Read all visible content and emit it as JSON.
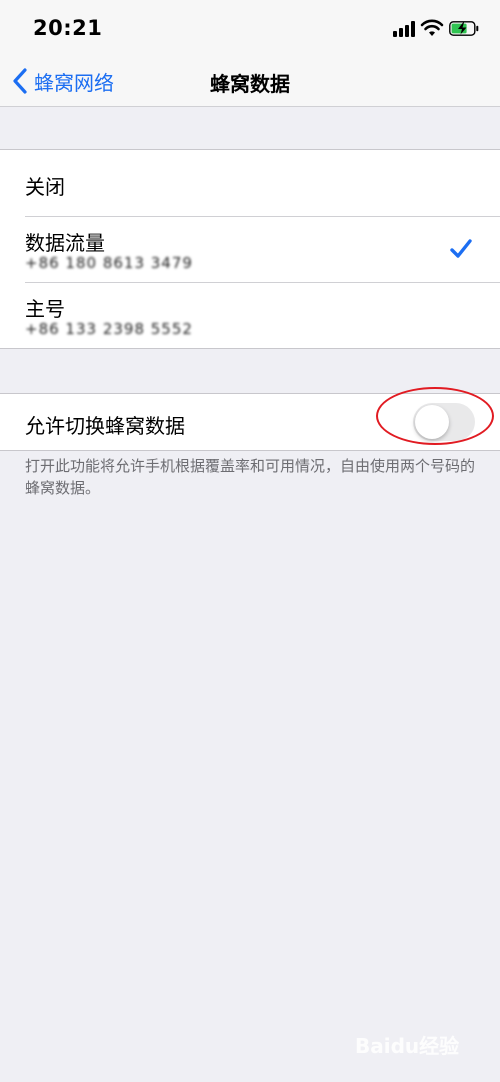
{
  "status_bar": {
    "time": "20:21"
  },
  "nav": {
    "back_label": "蜂窝网络",
    "title": "蜂窝数据"
  },
  "options": [
    {
      "title": "关闭",
      "subtitle": ""
    },
    {
      "title": "数据流量",
      "subtitle": "+86 180 8613 3479",
      "selected": true
    },
    {
      "title": "主号",
      "subtitle": "+86 133 2398 5552"
    }
  ],
  "switching": {
    "label": "允许切换蜂窝数据",
    "enabled": false,
    "note": "打开此功能将允许手机根据覆盖率和可用情况，自由使用两个号码的蜂窝数据。"
  },
  "colors": {
    "accent": "#1c6ef2",
    "annotation": "#e11b22"
  },
  "icons": [
    "signal-icon",
    "wifi-icon",
    "battery-charging-icon",
    "back-chevron-icon",
    "checkmark-icon"
  ],
  "watermark": "Baidu经验"
}
